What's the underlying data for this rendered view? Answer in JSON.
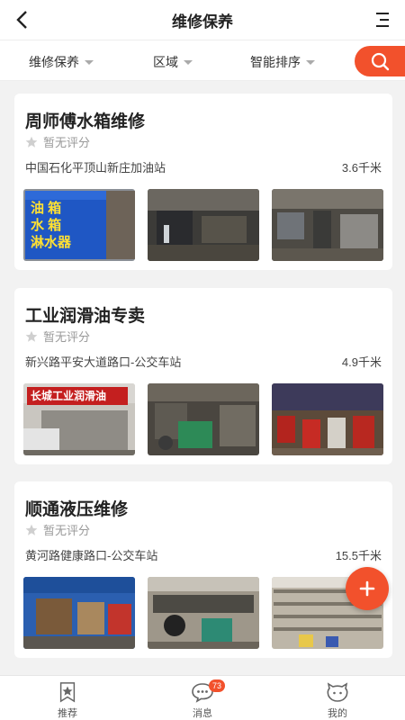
{
  "header": {
    "title": "维修保养"
  },
  "filters": [
    {
      "label": "维修保养"
    },
    {
      "label": "区域"
    },
    {
      "label": "智能排序"
    }
  ],
  "shops": [
    {
      "name": "周师傅水箱维修",
      "rating": "暂无评分",
      "address": "中国石化平顶山新庄加油站",
      "distance": "3.6千米",
      "photo_sign": [
        "油 箱",
        "水 箱",
        "淋水器"
      ]
    },
    {
      "name": "工业润滑油专卖",
      "rating": "暂无评分",
      "address": "新兴路平安大道路口-公交车站",
      "distance": "4.9千米",
      "photo_sign": [
        "长城工业润滑油"
      ]
    },
    {
      "name": "顺通液压维修",
      "rating": "暂无评分",
      "address": "黄河路健康路口-公交车站",
      "distance": "15.5千米",
      "photo_sign": []
    }
  ],
  "tabs": [
    {
      "label": "推荐",
      "icon": "star-icon"
    },
    {
      "label": "消息",
      "icon": "chat-icon",
      "badge": "73"
    },
    {
      "label": "我的",
      "icon": "face-icon"
    }
  ],
  "colors": {
    "accent": "#f2512c",
    "background": "#f2f2f2"
  }
}
